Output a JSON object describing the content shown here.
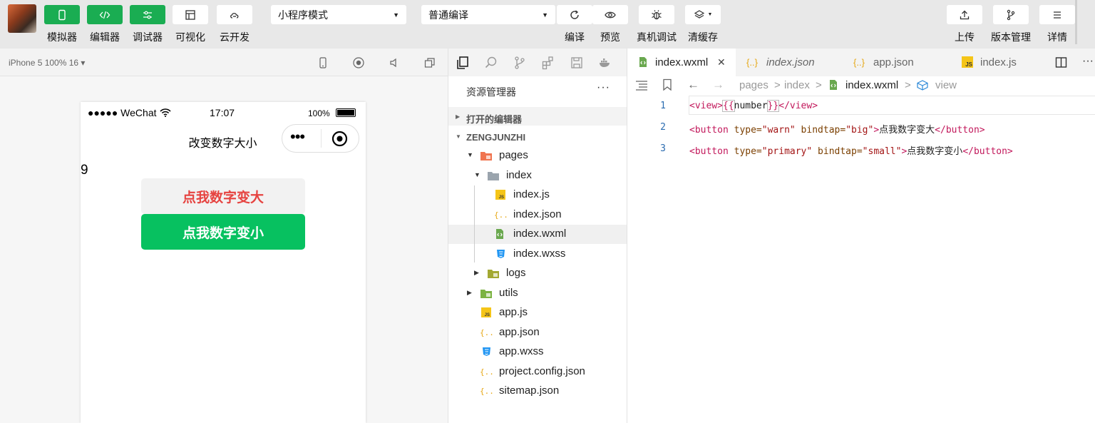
{
  "toolbar": {
    "buttons": [
      {
        "label": "模拟器",
        "icon": "phone-icon"
      },
      {
        "label": "编辑器",
        "icon": "code-icon"
      },
      {
        "label": "调试器",
        "icon": "sliders-icon"
      },
      {
        "label": "可视化",
        "icon": "layout-icon"
      },
      {
        "label": "云开发",
        "icon": "cloud-icon"
      }
    ],
    "mode_select": "小程序模式",
    "compile_select": "普通编译",
    "actions": [
      {
        "label": "编译",
        "icon": "refresh-icon"
      },
      {
        "label": "预览",
        "icon": "eye-icon"
      },
      {
        "label": "真机调试",
        "icon": "bug-icon"
      },
      {
        "label": "清缓存",
        "icon": "layers-icon"
      }
    ],
    "right_actions": [
      {
        "label": "上传",
        "icon": "upload-icon"
      },
      {
        "label": "版本管理",
        "icon": "branch-icon"
      },
      {
        "label": "详情",
        "icon": "menu-icon"
      }
    ]
  },
  "simulator": {
    "device": "iPhone 5 100% 16 ▾",
    "status_left": "●●●●● WeChat",
    "status_time": "17:07",
    "status_battery": "100%",
    "nav_title": "改变数字大小",
    "capsule_dots": "•••",
    "number": "9",
    "btn_big": "点我数字变大",
    "btn_small": "点我数字变小"
  },
  "explorer": {
    "header": "资源管理器",
    "more": "···",
    "open_editors": "打开的编辑器",
    "project": "ZENGJUNZHI",
    "tree": [
      {
        "label": "pages",
        "type": "folder-red",
        "depth": 0,
        "arrow": "▼"
      },
      {
        "label": "index",
        "type": "folder-gray",
        "depth": 1,
        "arrow": "▼"
      },
      {
        "label": "index.js",
        "type": "js",
        "depth": 2
      },
      {
        "label": "index.json",
        "type": "json",
        "depth": 2
      },
      {
        "label": "index.wxml",
        "type": "wxml",
        "depth": 2,
        "selected": true
      },
      {
        "label": "index.wxss",
        "type": "wxss",
        "depth": 2
      },
      {
        "label": "logs",
        "type": "folder-olive",
        "depth": 1,
        "arrow": "▶"
      },
      {
        "label": "utils",
        "type": "folder-green",
        "depth": 0,
        "arrow": "▶"
      },
      {
        "label": "app.js",
        "type": "js",
        "depth": 0
      },
      {
        "label": "app.json",
        "type": "json",
        "depth": 0
      },
      {
        "label": "app.wxss",
        "type": "wxss",
        "depth": 0
      },
      {
        "label": "project.config.json",
        "type": "json",
        "depth": 0
      },
      {
        "label": "sitemap.json",
        "type": "json",
        "depth": 0
      }
    ]
  },
  "editor": {
    "tabs": [
      {
        "label": "index.wxml",
        "close": "✕",
        "type": "wxml"
      },
      {
        "label": "index.json",
        "type": "json"
      },
      {
        "label": "app.json",
        "type": "json"
      },
      {
        "label": "index.js",
        "type": "js"
      }
    ],
    "crumbs": [
      "pages",
      ">",
      "index",
      ">",
      "index.wxml",
      ">",
      "view"
    ],
    "lines": [
      {
        "no": "1"
      },
      {
        "no": "2"
      },
      {
        "no": "3"
      }
    ],
    "code": {
      "l1_open": "<view>",
      "l1_brace_open": "{{",
      "l1_var": "number",
      "l1_brace_close": "}}",
      "l1_close": "</view>",
      "l2_tag": "<button",
      "l2_attr1": " type=",
      "l2_val1": "\"warn\"",
      "l2_attr2": " bindtap=",
      "l2_val2": "\"big\"",
      "l2_gt": ">",
      "l2_text": "点我数字变大",
      "l2_close": "</button>",
      "l3_tag": "<button",
      "l3_attr1": " type=",
      "l3_val1": "\"primary\"",
      "l3_attr2": " bindtap=",
      "l3_val2": "\"small\"",
      "l3_gt": ">",
      "l3_text": "点我数字变小",
      "l3_close": "</button>"
    }
  }
}
